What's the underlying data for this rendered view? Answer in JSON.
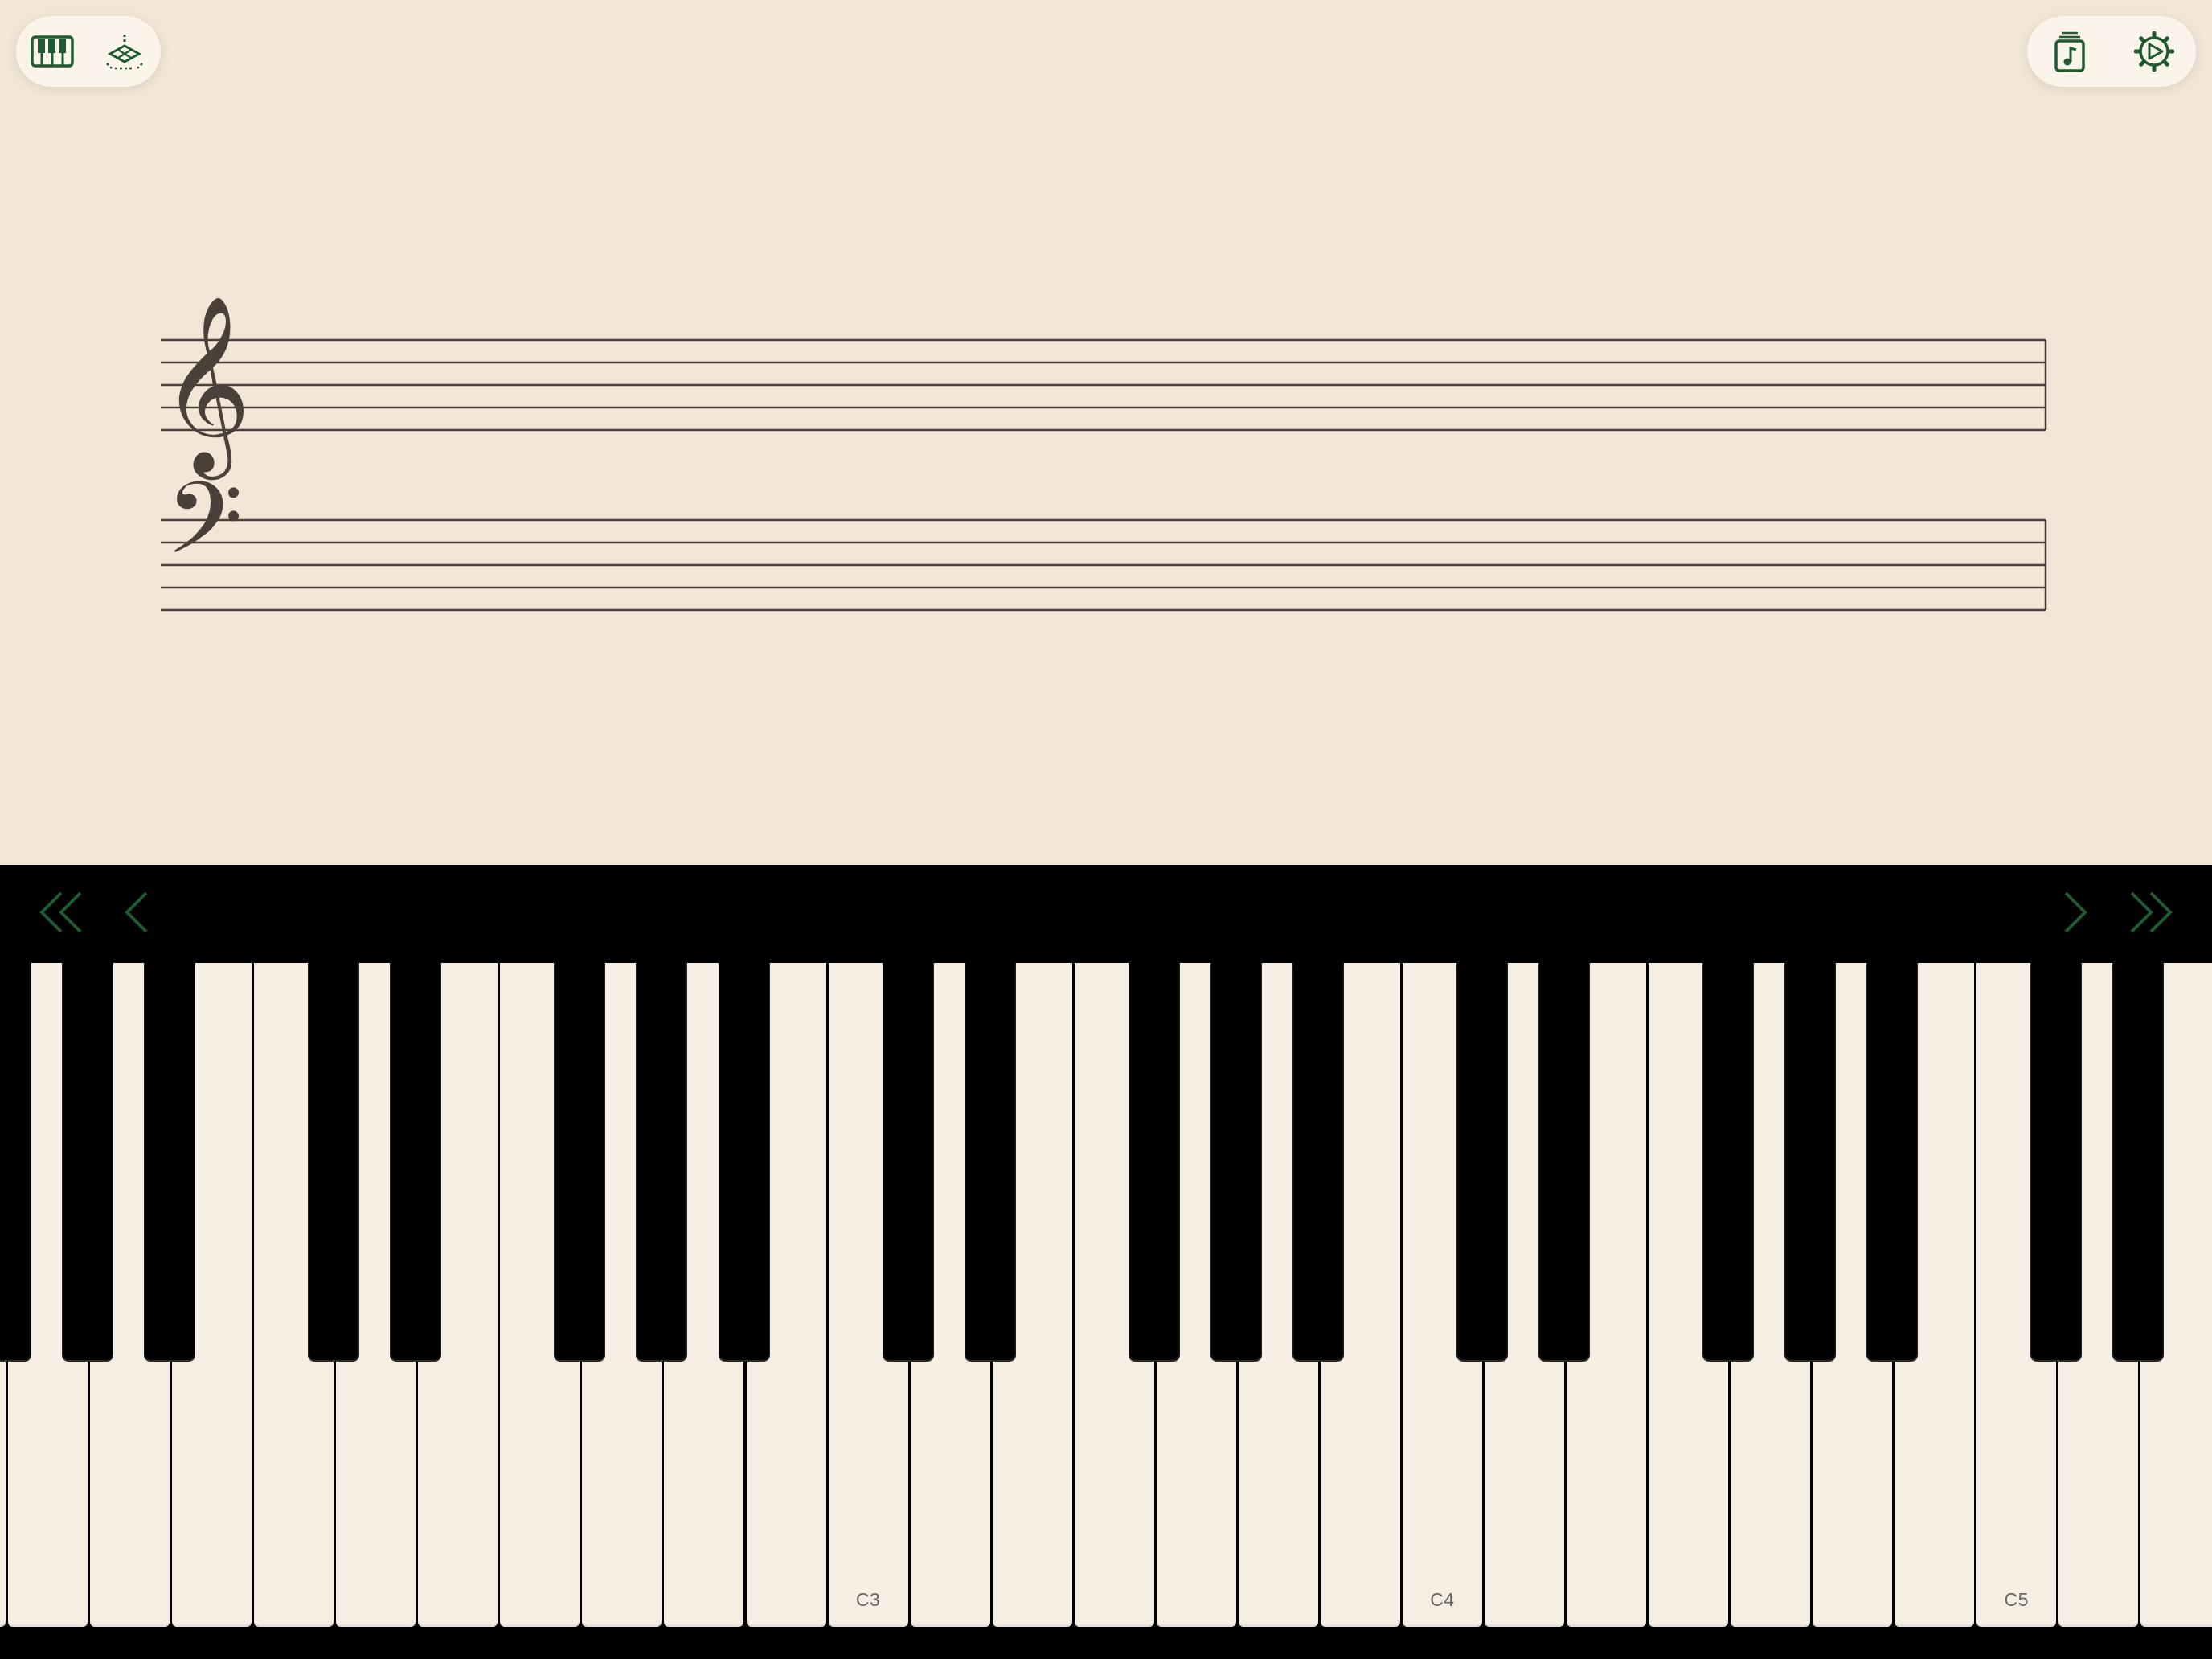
{
  "colors": {
    "background": "#f2e7d6",
    "accent": "#1f5a32",
    "white_key": "#f6eee3",
    "black_key": "#000000",
    "staff_line": "#4a403a"
  },
  "toolbar_left": [
    {
      "name": "keyboard-mode-button",
      "icon": "piano-keys-icon"
    },
    {
      "name": "ar-placement-button",
      "icon": "ar-plane-icon"
    }
  ],
  "toolbar_right": [
    {
      "name": "song-library-button",
      "icon": "music-book-icon"
    },
    {
      "name": "settings-button",
      "icon": "gear-play-icon"
    }
  ],
  "staff": {
    "treble_clef": "𝄞",
    "bass_clef": "𝄢"
  },
  "navigation": {
    "jump_left": "«",
    "step_left": "‹",
    "step_right": "›",
    "jump_right": "»"
  },
  "keyboard": {
    "white_keys": [
      "F1",
      "G1",
      "A1",
      "B1",
      "C2",
      "D2",
      "E2",
      "F2",
      "G2",
      "A2",
      "B2",
      "C3",
      "D3",
      "E3",
      "F3",
      "G3",
      "A3",
      "B3",
      "C4",
      "D4",
      "E4",
      "F4",
      "G4",
      "A4",
      "B4",
      "C5",
      "D5",
      "E5",
      "F5",
      "G5",
      "A5",
      "B5",
      "C6",
      "D6",
      "E6",
      "F6",
      "G6",
      "A6",
      "B6",
      "C7"
    ],
    "visible_labels": {
      "C3": "C3",
      "C4": "C4",
      "C5": "C5"
    }
  }
}
